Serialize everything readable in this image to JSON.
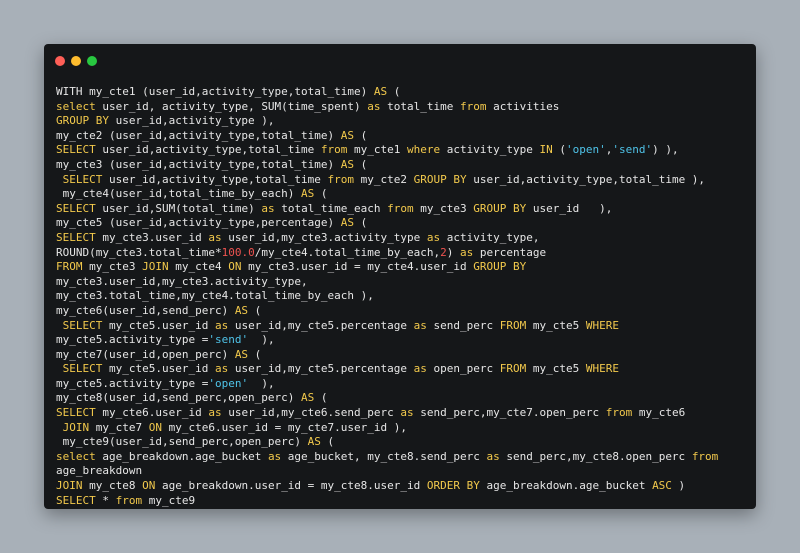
{
  "window": {
    "controls": [
      "close-icon",
      "minimize-icon",
      "maximize-icon"
    ]
  },
  "colors": {
    "background": "#a8b0b8",
    "window": "#151719",
    "plain": "#e6e6e6",
    "keyword": "#f2c94c",
    "string": "#4fc3e8",
    "number": "#ef5350",
    "close": "#ff5f57",
    "minimize": "#febc2e",
    "maximize": "#28c840"
  },
  "code": {
    "lines": [
      [
        [
          "p",
          "WITH my_cte1 (user_id,activity_type,total_time) "
        ],
        [
          "k",
          "AS"
        ],
        [
          "p",
          " ("
        ]
      ],
      [
        [
          "k",
          "select"
        ],
        [
          "p",
          " user_id, activity_type, SUM(time_spent) "
        ],
        [
          "k",
          "as"
        ],
        [
          "p",
          " total_time "
        ],
        [
          "k",
          "from"
        ],
        [
          "p",
          " activities"
        ]
      ],
      [
        [
          "k",
          "GROUP BY"
        ],
        [
          "p",
          " user_id,activity_type ),"
        ]
      ],
      [
        [
          "p",
          "my_cte2 (user_id,activity_type,total_time) "
        ],
        [
          "k",
          "AS"
        ],
        [
          "p",
          " ("
        ]
      ],
      [
        [
          "k",
          "SELECT"
        ],
        [
          "p",
          " user_id,activity_type,total_time "
        ],
        [
          "k",
          "from"
        ],
        [
          "p",
          " my_cte1 "
        ],
        [
          "k",
          "where"
        ],
        [
          "p",
          " activity_type "
        ],
        [
          "k",
          "IN"
        ],
        [
          "p",
          " ("
        ],
        [
          "s",
          "'open'"
        ],
        [
          "p",
          ","
        ],
        [
          "s",
          "'send'"
        ],
        [
          "p",
          ") ),"
        ]
      ],
      [
        [
          "p",
          "my_cte3 (user_id,activity_type,total_time) "
        ],
        [
          "k",
          "AS"
        ],
        [
          "p",
          " ("
        ]
      ],
      [
        [
          "p",
          " "
        ],
        [
          "k",
          "SELECT"
        ],
        [
          "p",
          " user_id,activity_type,total_time "
        ],
        [
          "k",
          "from"
        ],
        [
          "p",
          " my_cte2 "
        ],
        [
          "k",
          "GROUP BY"
        ],
        [
          "p",
          " user_id,activity_type,total_time ),"
        ]
      ],
      [
        [
          "p",
          " my_cte4(user_id,total_time_by_each) "
        ],
        [
          "k",
          "AS"
        ],
        [
          "p",
          " ("
        ]
      ],
      [
        [
          "k",
          "SELECT"
        ],
        [
          "p",
          " user_id,SUM(total_time) "
        ],
        [
          "k",
          "as"
        ],
        [
          "p",
          " total_time_each "
        ],
        [
          "k",
          "from"
        ],
        [
          "p",
          " my_cte3 "
        ],
        [
          "k",
          "GROUP BY"
        ],
        [
          "p",
          " user_id   ),"
        ]
      ],
      [
        [
          "p",
          "my_cte5 (user_id,activity_type,percentage) "
        ],
        [
          "k",
          "AS"
        ],
        [
          "p",
          " ("
        ]
      ],
      [
        [
          "k",
          "SELECT"
        ],
        [
          "p",
          " my_cte3.user_id "
        ],
        [
          "k",
          "as"
        ],
        [
          "p",
          " user_id,my_cte3.activity_type "
        ],
        [
          "k",
          "as"
        ],
        [
          "p",
          " activity_type,"
        ]
      ],
      [
        [
          "p",
          "ROUND(my_cte3.total_time*"
        ],
        [
          "n",
          "100.0"
        ],
        [
          "p",
          "/my_cte4.total_time_by_each,"
        ],
        [
          "n",
          "2"
        ],
        [
          "p",
          ") "
        ],
        [
          "k",
          "as"
        ],
        [
          "p",
          " percentage"
        ]
      ],
      [
        [
          "k",
          "FROM"
        ],
        [
          "p",
          " my_cte3 "
        ],
        [
          "k",
          "JOIN"
        ],
        [
          "p",
          " my_cte4 "
        ],
        [
          "k",
          "ON"
        ],
        [
          "p",
          " my_cte3.user_id = my_cte4.user_id "
        ],
        [
          "k",
          "GROUP BY"
        ]
      ],
      [
        [
          "p",
          "my_cte3.user_id,my_cte3.activity_type,"
        ]
      ],
      [
        [
          "p",
          "my_cte3.total_time,my_cte4.total_time_by_each ),"
        ]
      ],
      [
        [
          "p",
          "my_cte6(user_id,send_perc) "
        ],
        [
          "k",
          "AS"
        ],
        [
          "p",
          " ("
        ]
      ],
      [
        [
          "p",
          " "
        ],
        [
          "k",
          "SELECT"
        ],
        [
          "p",
          " my_cte5.user_id "
        ],
        [
          "k",
          "as"
        ],
        [
          "p",
          " user_id,my_cte5.percentage "
        ],
        [
          "k",
          "as"
        ],
        [
          "p",
          " send_perc "
        ],
        [
          "k",
          "FROM"
        ],
        [
          "p",
          " my_cte5 "
        ],
        [
          "k",
          "WHERE"
        ]
      ],
      [
        [
          "p",
          "my_cte5.activity_type ="
        ],
        [
          "s",
          "'send'"
        ],
        [
          "p",
          "  ),"
        ]
      ],
      [
        [
          "p",
          "my_cte7(user_id,open_perc) "
        ],
        [
          "k",
          "AS"
        ],
        [
          "p",
          " ("
        ]
      ],
      [
        [
          "p",
          " "
        ],
        [
          "k",
          "SELECT"
        ],
        [
          "p",
          " my_cte5.user_id "
        ],
        [
          "k",
          "as"
        ],
        [
          "p",
          " user_id,my_cte5.percentage "
        ],
        [
          "k",
          "as"
        ],
        [
          "p",
          " open_perc "
        ],
        [
          "k",
          "FROM"
        ],
        [
          "p",
          " my_cte5 "
        ],
        [
          "k",
          "WHERE"
        ]
      ],
      [
        [
          "p",
          "my_cte5.activity_type ="
        ],
        [
          "s",
          "'open'"
        ],
        [
          "p",
          "  ),"
        ]
      ],
      [
        [
          "p",
          "my_cte8(user_id,send_perc,open_perc) "
        ],
        [
          "k",
          "AS"
        ],
        [
          "p",
          " ("
        ]
      ],
      [
        [
          "k",
          "SELECT"
        ],
        [
          "p",
          " my_cte6.user_id "
        ],
        [
          "k",
          "as"
        ],
        [
          "p",
          " user_id,my_cte6.send_perc "
        ],
        [
          "k",
          "as"
        ],
        [
          "p",
          " send_perc,my_cte7.open_perc "
        ],
        [
          "k",
          "from"
        ],
        [
          "p",
          " my_cte6"
        ]
      ],
      [
        [
          "p",
          " "
        ],
        [
          "k",
          "JOIN"
        ],
        [
          "p",
          " my_cte7 "
        ],
        [
          "k",
          "ON"
        ],
        [
          "p",
          " my_cte6.user_id = my_cte7.user_id ),"
        ]
      ],
      [
        [
          "p",
          " my_cte9(user_id,send_perc,open_perc) "
        ],
        [
          "k",
          "AS"
        ],
        [
          "p",
          " ("
        ]
      ],
      [
        [
          "k",
          "select"
        ],
        [
          "p",
          " age_breakdown.age_bucket "
        ],
        [
          "k",
          "as"
        ],
        [
          "p",
          " age_bucket, my_cte8.send_perc "
        ],
        [
          "k",
          "as"
        ],
        [
          "p",
          " send_perc,my_cte8.open_perc "
        ],
        [
          "k",
          "from"
        ]
      ],
      [
        [
          "p",
          "age_breakdown"
        ]
      ],
      [
        [
          "k",
          "JOIN"
        ],
        [
          "p",
          " my_cte8 "
        ],
        [
          "k",
          "ON"
        ],
        [
          "p",
          " age_breakdown.user_id = my_cte8.user_id "
        ],
        [
          "k",
          "ORDER BY"
        ],
        [
          "p",
          " age_breakdown.age_bucket "
        ],
        [
          "k",
          "ASC"
        ],
        [
          "p",
          " )"
        ]
      ],
      [
        [
          "k",
          "SELECT"
        ],
        [
          "p",
          " * "
        ],
        [
          "k",
          "from"
        ],
        [
          "p",
          " my_cte9"
        ]
      ]
    ]
  }
}
